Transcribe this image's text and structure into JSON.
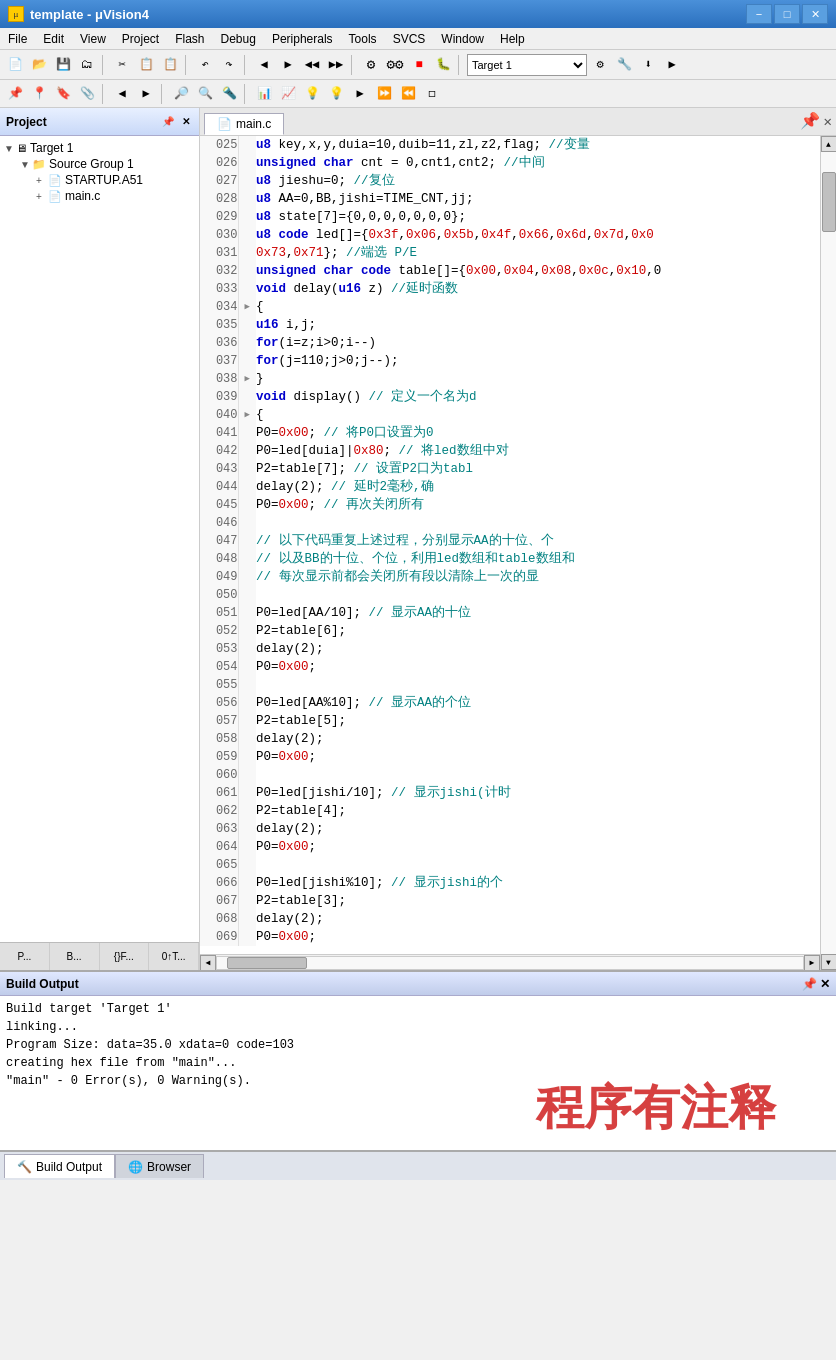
{
  "titlebar": {
    "icon": "μ",
    "title": "template - μVision4",
    "minimize": "−",
    "maximize": "□",
    "close": "✕"
  },
  "menubar": {
    "items": [
      "File",
      "Edit",
      "View",
      "Project",
      "Flash",
      "Debug",
      "Peripherals",
      "Tools",
      "SVCS",
      "Window",
      "Help"
    ]
  },
  "toolbar": {
    "target_select": "Target 1"
  },
  "project": {
    "header": "Project",
    "tree": [
      {
        "indent": 0,
        "expand": "▼",
        "icon": "🖥",
        "label": "Target 1"
      },
      {
        "indent": 1,
        "expand": "▼",
        "icon": "📁",
        "label": "Source Group 1"
      },
      {
        "indent": 2,
        "expand": "+",
        "icon": "📄",
        "label": "STARTUP.A51"
      },
      {
        "indent": 2,
        "expand": "+",
        "icon": "📄",
        "label": "main.c"
      }
    ],
    "bottom_tabs": [
      "P...",
      "B...",
      "{}F...",
      "0↑T..."
    ]
  },
  "code": {
    "tab": "main.c",
    "lines": [
      {
        "num": "025",
        "marker": "",
        "code": "u8 key,x,y,duia=10,duib=11,zl,z2,flag;      //变量"
      },
      {
        "num": "026",
        "marker": "",
        "code": "unsigned char cnt = 0,cnt1,cnt2;             //中间"
      },
      {
        "num": "027",
        "marker": "",
        "code": "u8 jieshu=0;  //复位"
      },
      {
        "num": "028",
        "marker": "",
        "code": "u8 AA=0,BB,jishi=TIME_CNT,jj;"
      },
      {
        "num": "029",
        "marker": "",
        "code": "u8  state[7]={0,0,0,0,0,0,0};"
      },
      {
        "num": "030",
        "marker": "",
        "code": "u8  code led[]={0x3f,0x06,0x5b,0x4f,0x66,0x6d,0x7d,0x0"
      },
      {
        "num": "031",
        "marker": "",
        "code": "                0x73,0x71};        //端选   P/E"
      },
      {
        "num": "032",
        "marker": "",
        "code": "unsigned char code table[]={0x00,0x04,0x08,0x0c,0x10,0"
      },
      {
        "num": "033",
        "marker": "",
        "code": "void delay(u16 z)               //延时函数"
      },
      {
        "num": "034",
        "marker": "▶",
        "code": "{"
      },
      {
        "num": "035",
        "marker": "",
        "code": "    u16 i,j;"
      },
      {
        "num": "036",
        "marker": "",
        "code": "    for(i=z;i>0;i--)"
      },
      {
        "num": "037",
        "marker": "",
        "code": "        for(j=110;j>0;j--);"
      },
      {
        "num": "038",
        "marker": "▶",
        "code": "}"
      },
      {
        "num": "039",
        "marker": "",
        "code": "void display()                   // 定义一个名为d"
      },
      {
        "num": "040",
        "marker": "▶",
        "code": "{"
      },
      {
        "num": "041",
        "marker": "",
        "code": "    P0=0x00;                     //  将P0口设置为0"
      },
      {
        "num": "042",
        "marker": "",
        "code": "    P0=led[duia]|0x80;           //  将led数组中对"
      },
      {
        "num": "043",
        "marker": "",
        "code": "    P2=table[7];                 //  设置P2口为tabl"
      },
      {
        "num": "044",
        "marker": "",
        "code": "    delay(2);                    //  延时2毫秒,确"
      },
      {
        "num": "045",
        "marker": "",
        "code": "    P0=0x00;                     //  再次关闭所有"
      },
      {
        "num": "046",
        "marker": "",
        "code": ""
      },
      {
        "num": "047",
        "marker": "",
        "code": "    // 以下代码重复上述过程，分别显示AA的十位、个"
      },
      {
        "num": "048",
        "marker": "",
        "code": "    // 以及BB的十位、个位，利用led数组和table数组和"
      },
      {
        "num": "049",
        "marker": "",
        "code": "    // 每次显示前都会关闭所有段以清除上一次的显"
      },
      {
        "num": "050",
        "marker": "",
        "code": ""
      },
      {
        "num": "051",
        "marker": "",
        "code": "    P0=led[AA/10];               //  显示AA的十位"
      },
      {
        "num": "052",
        "marker": "",
        "code": "    P2=table[6];"
      },
      {
        "num": "053",
        "marker": "",
        "code": "    delay(2);"
      },
      {
        "num": "054",
        "marker": "",
        "code": "    P0=0x00;"
      },
      {
        "num": "055",
        "marker": "",
        "code": ""
      },
      {
        "num": "056",
        "marker": "",
        "code": "    P0=led[AA%10];               //  显示AA的个位"
      },
      {
        "num": "057",
        "marker": "",
        "code": "    P2=table[5];"
      },
      {
        "num": "058",
        "marker": "",
        "code": "    delay(2);"
      },
      {
        "num": "059",
        "marker": "",
        "code": "    P0=0x00;"
      },
      {
        "num": "060",
        "marker": "",
        "code": ""
      },
      {
        "num": "061",
        "marker": "",
        "code": "    P0=led[jishi/10];            //  显示jishi(计时"
      },
      {
        "num": "062",
        "marker": "",
        "code": "    P2=table[4];"
      },
      {
        "num": "063",
        "marker": "",
        "code": "    delay(2);"
      },
      {
        "num": "064",
        "marker": "",
        "code": "    P0=0x00;"
      },
      {
        "num": "065",
        "marker": "",
        "code": ""
      },
      {
        "num": "066",
        "marker": "",
        "code": "    P0=led[jishi%10];            //  显示jishi的个"
      },
      {
        "num": "067",
        "marker": "",
        "code": "    P2=table[3];"
      },
      {
        "num": "068",
        "marker": "",
        "code": "    delay(2);"
      },
      {
        "num": "069",
        "marker": "",
        "code": "    P0=0x00;"
      }
    ]
  },
  "build_output": {
    "header": "Build Output",
    "lines": [
      "Build target 'Target 1'",
      "linking...",
      "Program Size: data=35.0 xdata=0 code=103",
      "creating hex file from \"main\"...",
      "\"main\" - 0 Error(s), 0 Warning(s)."
    ],
    "cn_overlay": "程序有注释"
  },
  "bottom_tabs": [
    {
      "label": "Build Output",
      "active": true
    },
    {
      "label": "Browser",
      "active": false
    }
  ],
  "icons": {
    "folder": "📁",
    "file": "📄",
    "target": "🖥",
    "build": "🔨",
    "browser": "🌐"
  }
}
